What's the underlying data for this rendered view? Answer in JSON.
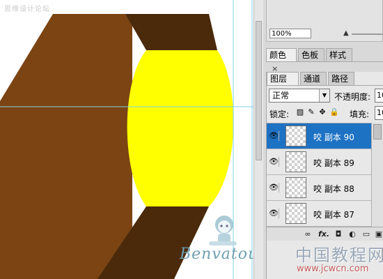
{
  "canvas": {
    "watermark_top": "思缘设计论坛",
    "watermark_name": "Benvatou",
    "colors": {
      "brown": "#7b4412",
      "dark_brown": "#4a2a0b",
      "yellow": "#ffff00",
      "guide": "#7fd3e6"
    }
  },
  "navigator": {
    "zoom_value": "100%"
  },
  "color_panel": {
    "tabs": [
      {
        "label": "颜色",
        "close": "×"
      },
      {
        "label": "色板",
        "close": ""
      },
      {
        "label": "样式",
        "close": ""
      }
    ]
  },
  "layers_panel": {
    "tabs": [
      {
        "label": "图层",
        "close": "×"
      },
      {
        "label": "通道",
        "close": ""
      },
      {
        "label": "路径",
        "close": ""
      }
    ],
    "blend_mode": "正常",
    "opacity_label": "不透明度:",
    "opacity_value": "10",
    "lock_label": "锁定:",
    "fill_label": "填充:",
    "fill_value": "10",
    "layers": [
      {
        "name": "咬 副本 90",
        "selected": true
      },
      {
        "name": "咬 副本 89",
        "selected": false
      },
      {
        "name": "咬 副本 88",
        "selected": false
      },
      {
        "name": "咬 副本 87",
        "selected": false
      }
    ],
    "selected_color": "#1d72c4"
  },
  "site_watermark": {
    "cn": "中国教程网",
    "url": "www.jcwcn.com"
  }
}
